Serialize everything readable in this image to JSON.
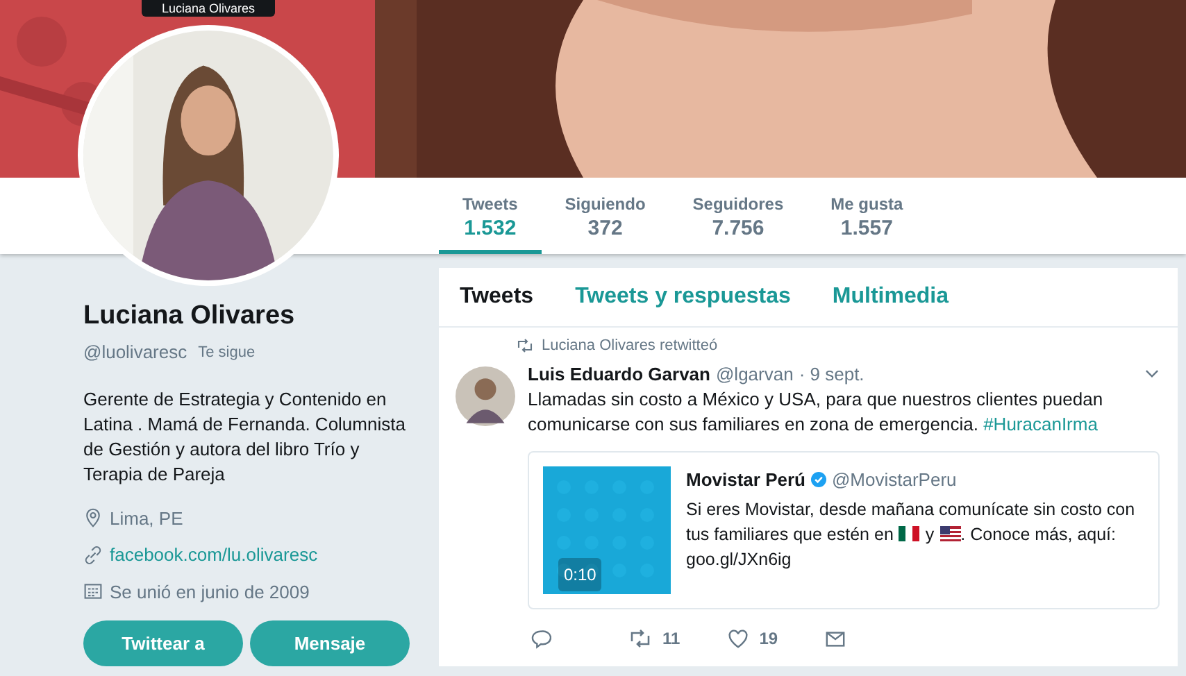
{
  "tooltip": {
    "text": "Luciana Olivares"
  },
  "stats": [
    {
      "label": "Tweets",
      "value": "1.532",
      "selected": true
    },
    {
      "label": "Siguiendo",
      "value": "372",
      "selected": false
    },
    {
      "label": "Seguidores",
      "value": "7.756",
      "selected": false
    },
    {
      "label": "Me gusta",
      "value": "1.557",
      "selected": false
    }
  ],
  "profile": {
    "name": "Luciana Olivares",
    "handle": "@luolivaresc",
    "follows_you": "Te sigue",
    "bio": "Gerente de Estrategia y Contenido en Latina . Mamá de Fernanda. Columnista de Gestión y autora del libro Trío y Terapia de Pareja",
    "location": "Lima, PE",
    "website": "facebook.com/lu.olivaresc",
    "joined": "Se unió en junio de 2009",
    "buttons": [
      "Twittear a",
      "Mensaje"
    ]
  },
  "timeline_tabs": [
    {
      "label": "Tweets",
      "selected": true
    },
    {
      "label": "Tweets y respuestas",
      "selected": false
    },
    {
      "label": "Multimedia",
      "selected": false
    }
  ],
  "tweet": {
    "context": "Luciana Olivares retwitteó",
    "author": "Luis Eduardo Garvan",
    "handle": "@lgarvan",
    "time": "· 9 sept.",
    "text": "Llamadas sin costo a México y USA, para que nuestros clientes puedan comunicarse con sus familiares en zona de emergencia.",
    "hashtag": "#HuracanIrma",
    "quote": {
      "author": "Movistar Perú",
      "verified": true,
      "handle": "@MovistarPeru",
      "text_1": "Si eres Movistar, desde mañana comunícate sin costo con",
      "text_2": "tus familiares que estén en",
      "text_3": "y",
      "text_4": ". Conoce más, aquí:",
      "text_5": "goo.gl/JXn6ig",
      "duration": "0:10"
    },
    "retweets": "11",
    "likes": "19"
  }
}
